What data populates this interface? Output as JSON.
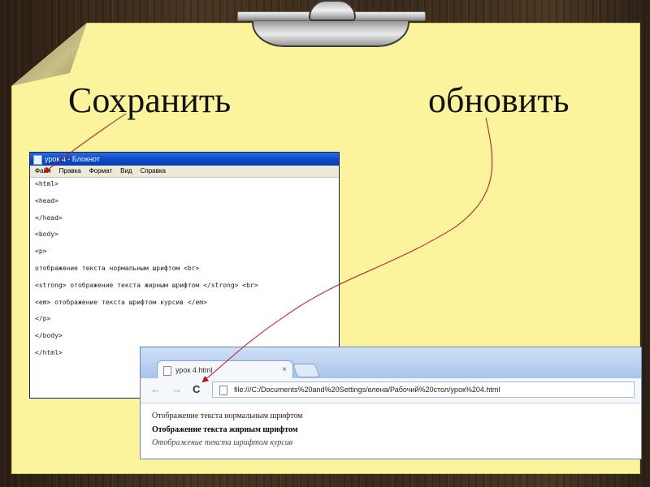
{
  "slide": {
    "word_save": "Сохранить",
    "word_refresh": "обновить"
  },
  "notepad": {
    "title": "урок 4 - Блокнот",
    "menu": [
      "Файл",
      "Правка",
      "Формат",
      "Вид",
      "Справка"
    ],
    "lines": [
      "<html>",
      "<head>",
      "</head>",
      "<body>",
      "<p>",
      "отображение текста нормальным шрифтом <br>",
      "<strong> отображение текста жирным шрифтом </strong> <br>",
      "<em> отображение текста шрифтом курсив </em>",
      "</p>",
      "</body>",
      "</html>"
    ]
  },
  "browser": {
    "tab_title": "урок 4.html",
    "tab_close": "×",
    "url": "file:///C:/Documents%20and%20Settings/елена/Рабочий%20стол/урок%204.html",
    "back": "←",
    "forward": "→",
    "reload": "C",
    "content": {
      "normal": "Отображение текста нормальным шрифтом",
      "bold": "Отображение текста жирным шрифтом",
      "italic": "Отображение текста шрифтом курсив"
    }
  },
  "colors": {
    "paper": "#fbf49c",
    "arrow": "#b3151e",
    "wood": "#3a2b1c"
  }
}
